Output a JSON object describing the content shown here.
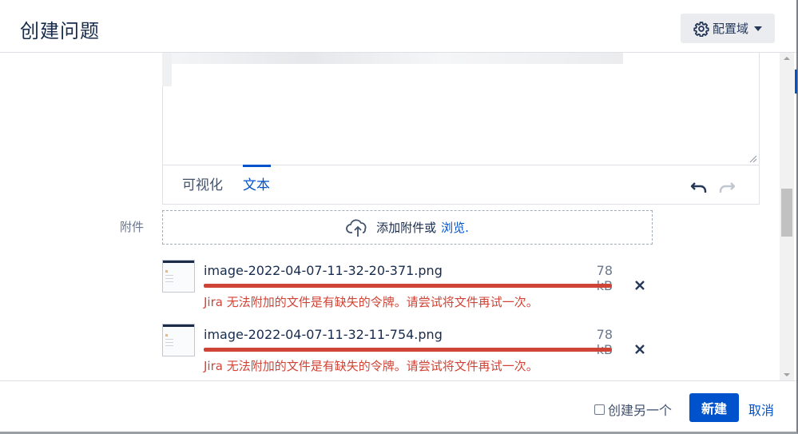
{
  "header": {
    "title": "创建问题",
    "config_button": {
      "label": "配置域",
      "icon": "gear-icon"
    }
  },
  "editor": {
    "tabs": [
      {
        "label": "可视化",
        "active": false
      },
      {
        "label": "文本",
        "active": true
      }
    ],
    "toolbar": {
      "undo_icon": "undo-icon",
      "redo_icon": "redo-icon"
    }
  },
  "attachments": {
    "label": "附件",
    "dropzone": {
      "text": "添加附件或",
      "browse": "浏览.",
      "icon": "upload-cloud-icon"
    },
    "files": [
      {
        "name": "image-2022-04-07-11-32-20-371.png",
        "size": "78 kB",
        "error": "Jira 无法附加的文件是有缺失的令牌。请尝试将文件再试一次。",
        "progress": 1.0
      },
      {
        "name": "image-2022-04-07-11-32-11-754.png",
        "size": "78 kB",
        "error": "Jira 无法附加的文件是有缺失的令牌。请尝试将文件再试一次。",
        "progress": 1.0
      }
    ]
  },
  "footer": {
    "create_another_label": "创建另一个",
    "create_another_checked": false,
    "create_button": "新建",
    "cancel_link": "取消"
  },
  "colors": {
    "primary": "#0052cc",
    "error": "#d04437",
    "text": "#172b4d",
    "muted": "#6b778c"
  }
}
